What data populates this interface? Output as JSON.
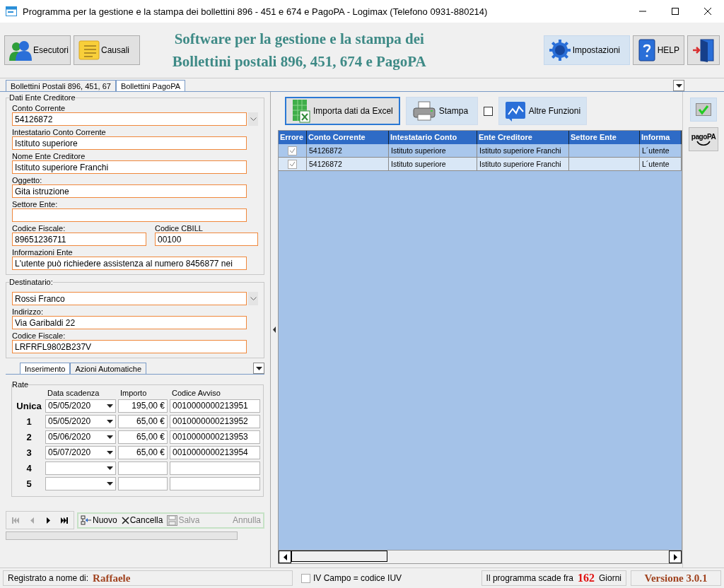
{
  "window": {
    "title": "Programma per la gestione e la stampa dei bollettini 896 - 451 e 674 e PagoPA - Logimax (Telefono 0931-880214)"
  },
  "toolbar": {
    "left_buttons": [
      {
        "label": "Esecutori",
        "kind": "people"
      },
      {
        "label": "Causali",
        "kind": "notes"
      }
    ],
    "heading": [
      "Software per la gestione e la stampa dei",
      "Bollettini postali 896, 451, 674 e PagoPA"
    ],
    "right_buttons": [
      {
        "label": "Impostazioni",
        "kind": "gear",
        "highlighted": true
      },
      {
        "label": "HELP",
        "kind": "help",
        "highlighted": false
      },
      {
        "kind": "exit",
        "highlighted": false
      }
    ]
  },
  "tabs": [
    {
      "label": "Bollettini Postali 896, 451, 67",
      "selected": false
    },
    {
      "label": "Bollettini PagoPA",
      "selected": true
    }
  ],
  "ente": {
    "title": "Dati Ente Creditore",
    "fields": [
      {
        "kind": "combo",
        "label": "Conto Corrente",
        "value": "54126872"
      },
      {
        "kind": "text",
        "label": "Intestatario Conto Corrente",
        "value": "Istituto superiore"
      },
      {
        "kind": "text",
        "label": "Nome Ente Creditore",
        "value": "Istituto superiore Franchi"
      },
      {
        "kind": "text",
        "label": "Oggetto:",
        "value": "Gita istruzione"
      },
      {
        "kind": "text",
        "label": "Settore Ente:"
      },
      {
        "kind": "half",
        "label": "Codice Fiscale:",
        "value": "89651236711"
      },
      {
        "kind": "half",
        "label": "Codice CBILL",
        "value": "00100"
      },
      {
        "kind": "text",
        "label": "Informazioni Ente",
        "value": "L'utente può richiedere assistenza al numero 8456877 nei"
      }
    ]
  },
  "destinatario": {
    "title": "Destinatario:",
    "fields": [
      {
        "kind": "combo",
        "value": "Rossi Franco"
      },
      {
        "kind": "text",
        "label": "Indirizzo:",
        "value": "Via Garibaldi 22"
      },
      {
        "kind": "text",
        "label": "Codice Fiscale:",
        "value": "LRFRFL9802B237V"
      }
    ]
  },
  "subtabs": [
    {
      "label": "Inserimento",
      "selected": true
    },
    {
      "label": "Azioni Automatiche",
      "selected": false
    }
  ],
  "rate": {
    "title": "Rate",
    "columns": [
      "Data scadenza",
      "Importo",
      "Codice Avviso"
    ],
    "rows": [
      {
        "label": "Unica",
        "date": "05/05/2020",
        "amount": "195,00 €",
        "code": "0010000000213951"
      },
      {
        "label": "1",
        "date": "05/05/2020",
        "amount": "65,00 €",
        "code": "0010000000213952"
      },
      {
        "label": "2",
        "date": "05/06/2020",
        "amount": "65,00 €",
        "code": "0010000000213953"
      },
      {
        "label": "3",
        "date": "05/07/2020",
        "amount": "65,00 €",
        "code": "0010000000213954"
      },
      {
        "label": "4"
      },
      {
        "label": "5"
      }
    ]
  },
  "navigator": [
    {
      "kind": "first",
      "disabled": true
    },
    {
      "kind": "prev",
      "disabled": true
    },
    {
      "kind": "next",
      "disabled": false
    },
    {
      "kind": "last",
      "disabled": false
    }
  ],
  "actions": [
    {
      "kind": "new",
      "label": "Nuovo",
      "disabled": false
    },
    {
      "kind": "delete",
      "label": "Cancella",
      "disabled": false
    },
    {
      "kind": "save",
      "label": "Salva",
      "disabled": true
    },
    {
      "kind": "plain",
      "label": "Annulla",
      "disabled": true
    }
  ],
  "progress": {
    "level": 0
  },
  "grid_toolbar": [
    {
      "kind": "excel",
      "label": "Importa dati da Excel",
      "focused": true
    },
    {
      "kind": "printer",
      "label": "Stampa",
      "focused": false
    },
    {
      "kind": "checkbox",
      "checked": false
    },
    {
      "kind": "chart",
      "label": "Altre Funzioni",
      "focused": false
    }
  ],
  "grid": {
    "columns": [
      "Errore",
      "Conto Corrente",
      "Intestatario Conto",
      "Ente Creditore",
      "Settore Ente",
      "Informa"
    ],
    "rows": [
      {
        "selected": true,
        "error": true,
        "cells": [
          "",
          "54126872",
          "Istituto superiore",
          "Istituto superiore Franchi",
          "",
          "L´utente"
        ]
      },
      {
        "selected": false,
        "error": true,
        "cells": [
          "",
          "54126872",
          "Istituto superiore",
          "Istituto superiore Franchi",
          "",
          "L´utente"
        ]
      }
    ]
  },
  "side_buttons": [
    {
      "kind": "check"
    },
    {
      "kind": "pagopa",
      "label": "pagoPA"
    }
  ],
  "status_bar": {
    "registered_label": "Registrato a nome di:",
    "registered_name": "Raffaele",
    "iuv_checkbox": {
      "label": "IV Campo = codice IUV",
      "checked": false
    },
    "expiry_prefix": "Il programma scade fra",
    "expiry_days": "162",
    "expiry_suffix": "Giorni",
    "version": "Versione 3.0.1"
  }
}
